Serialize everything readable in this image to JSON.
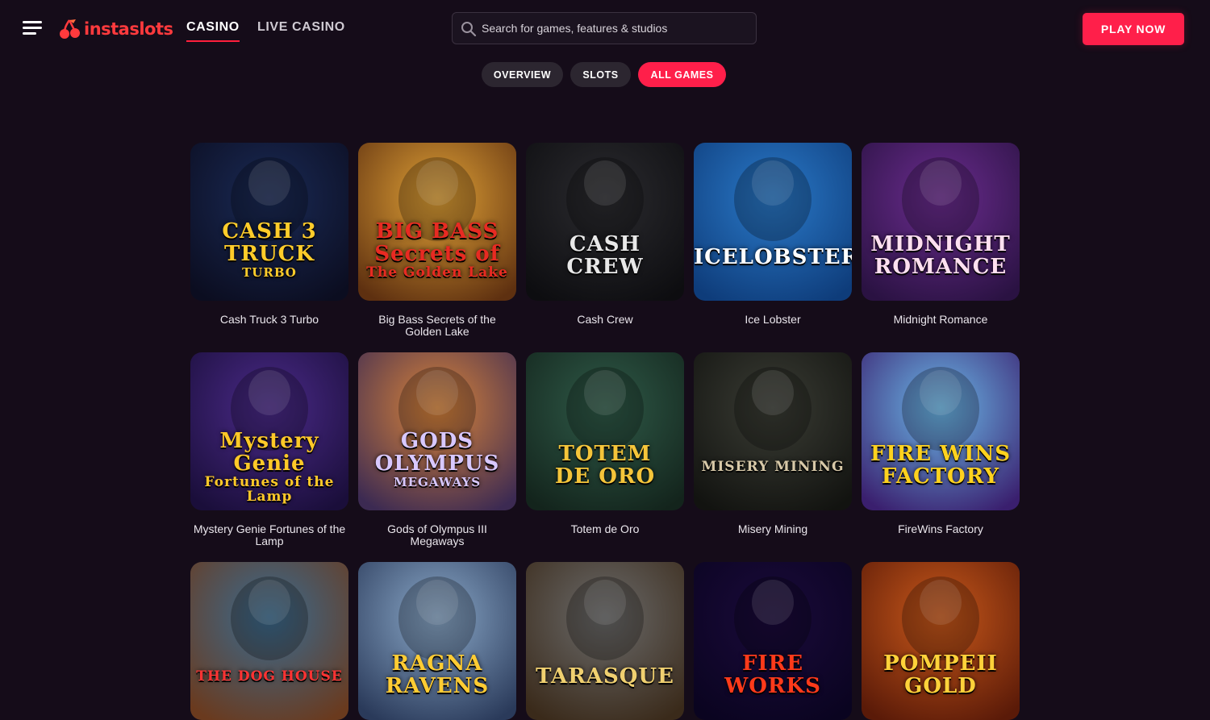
{
  "header": {
    "logo_text": "instaslots",
    "nav": [
      {
        "label": "CASINO",
        "active": true
      },
      {
        "label": "LIVE CASINO",
        "active": false
      }
    ],
    "search_placeholder": "Search for games, features & studios",
    "play_label": "PLAY NOW"
  },
  "tabs": [
    {
      "label": "OVERVIEW",
      "active": false
    },
    {
      "label": "SLOTS",
      "active": false
    },
    {
      "label": "ALL GAMES",
      "active": true
    }
  ],
  "colors": {
    "background": "#150c19",
    "accent": "#ff1f4a",
    "tab_bg": "#2c2630"
  },
  "games": [
    {
      "title": "Cash Truck 3 Turbo",
      "logo": [
        "CASH 3",
        "TRUCK",
        "TURBO"
      ],
      "bg1": "#1a2a55",
      "bg2": "#0b0d20",
      "fg": "#ffcc2a"
    },
    {
      "title": "Big Bass Secrets of the Golden Lake",
      "logo": [
        "BIG BASS",
        "Secrets of",
        "The Golden Lake"
      ],
      "bg1": "#e0a136",
      "bg2": "#5e3010",
      "fg": "#e82a22"
    },
    {
      "title": "Cash Crew",
      "logo": [
        "CASH",
        "CREW"
      ],
      "bg1": "#2b2b2f",
      "bg2": "#0d0d10",
      "fg": "#e8e8e8"
    },
    {
      "title": "Ice Lobster",
      "logo": [
        "ICELOBSTER"
      ],
      "bg1": "#2a79c8",
      "bg2": "#0e3c7a",
      "fg": "#ffffff"
    },
    {
      "title": "Midnight Romance",
      "logo": [
        "MIDNIGHT",
        "ROMANCE"
      ],
      "bg1": "#6a2c8e",
      "bg2": "#2a1242",
      "fg": "#ffe0f0"
    },
    {
      "title": "Mystery Genie Fortunes of the Lamp",
      "logo": [
        "Mystery",
        "Genie",
        "Fortunes of the Lamp"
      ],
      "bg1": "#4a2a88",
      "bg2": "#1a0e3a",
      "fg": "#ffc928"
    },
    {
      "title": "Gods of Olympus III Megaways",
      "logo": [
        "GODS",
        "OLYMPUS",
        "MEGAWAYS"
      ],
      "bg1": "#d9843a",
      "bg2": "#3c2a52",
      "fg": "#d8c8ff"
    },
    {
      "title": "Totem de Oro",
      "logo": [
        "TOTEM",
        "DE ORO"
      ],
      "bg1": "#2f5a48",
      "bg2": "#13241c",
      "fg": "#f5c53a"
    },
    {
      "title": "Misery Mining",
      "logo": [
        "MISERY MINING"
      ],
      "bg1": "#3a3c34",
      "bg2": "#121310",
      "fg": "#d8c9a8"
    },
    {
      "title": "FireWins Factory",
      "logo": [
        "FIRE WINS",
        "FACTORY"
      ],
      "bg1": "#6bb8e8",
      "bg2": "#3a1f6e",
      "fg": "#ffd21e"
    },
    {
      "title": "",
      "logo": [
        "THE DOG HOUSE"
      ],
      "bg1": "#3a6a8e",
      "bg2": "#6a3a1e",
      "fg": "#f33"
    },
    {
      "title": "",
      "logo": [
        "RAGNA",
        "RAVENS"
      ],
      "bg1": "#8aa8c8",
      "bg2": "#2a3a5a",
      "fg": "#ffcc33"
    },
    {
      "title": "",
      "logo": [
        "TARASQUE"
      ],
      "bg1": "#6a6a6a",
      "bg2": "#3a2a1a",
      "fg": "#f0d070"
    },
    {
      "title": "",
      "logo": [
        "FIRE",
        "WORKS"
      ],
      "bg1": "#1a0a3a",
      "bg2": "#0a0420",
      "fg": "#ff3a1a"
    },
    {
      "title": "",
      "logo": [
        "POMPEII",
        "GOLD"
      ],
      "bg1": "#c8581a",
      "bg2": "#5a1a08",
      "fg": "#ffd23a"
    }
  ]
}
